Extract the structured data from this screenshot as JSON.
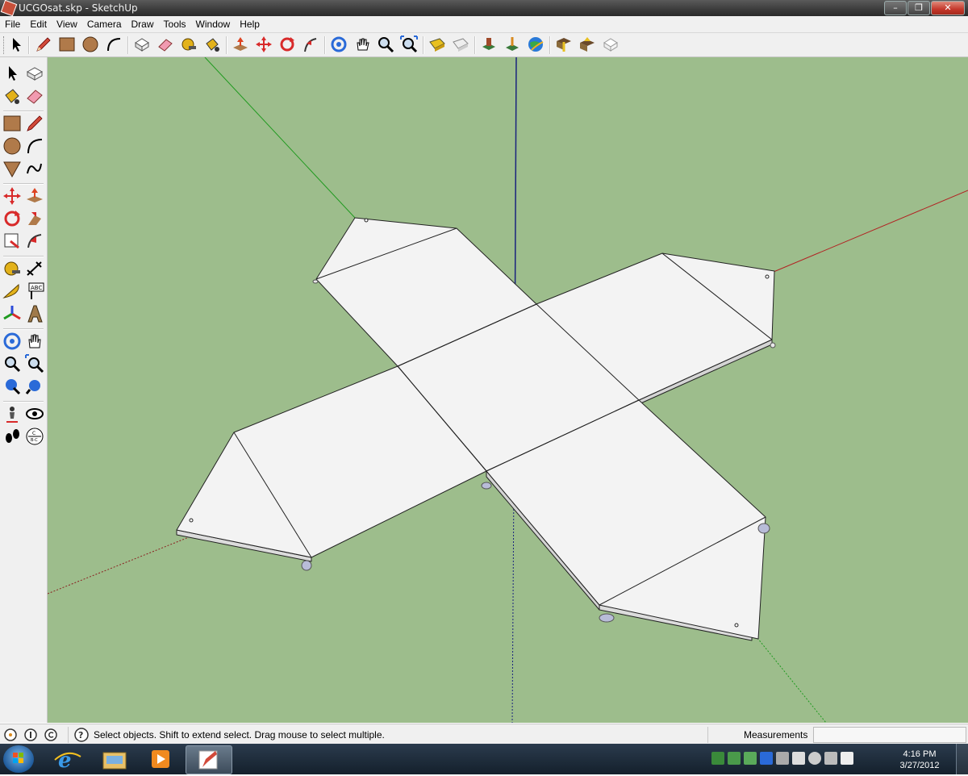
{
  "window": {
    "title": "UCGOsat.skp - SketchUp"
  },
  "menu": [
    "File",
    "Edit",
    "View",
    "Camera",
    "Draw",
    "Tools",
    "Window",
    "Help"
  ],
  "toolbar_icons": [
    "select-icon",
    "pencil-icon",
    "rectangle-icon",
    "circle-icon",
    "arc-icon",
    "make-component-icon",
    "eraser-icon",
    "tape-measure-icon",
    "paint-bucket-icon",
    "push-pull-icon",
    "move-icon",
    "rotate-icon",
    "follow-me-icon",
    "orbit-icon",
    "pan-icon",
    "zoom-icon",
    "zoom-extents-icon",
    "get-models-icon",
    "share-model-icon",
    "get-photo-texture-icon",
    "place-model-icon",
    "google-earth-icon",
    "get-components-icon",
    "share-component-icon",
    "model-info-icon"
  ],
  "status": {
    "text": "Select objects. Shift to extend select. Drag mouse to select multiple.",
    "measurements_label": "Measurements",
    "measurements_value": ""
  },
  "clock": {
    "time": "4:16 PM",
    "date": "3/27/2012"
  },
  "colors": {
    "viewport_bg": "#9dbd8c",
    "face": "#f2f2f2",
    "red_axis": "#b22222",
    "green_axis": "#1f9a1f",
    "blue_axis": "#1a237e"
  }
}
